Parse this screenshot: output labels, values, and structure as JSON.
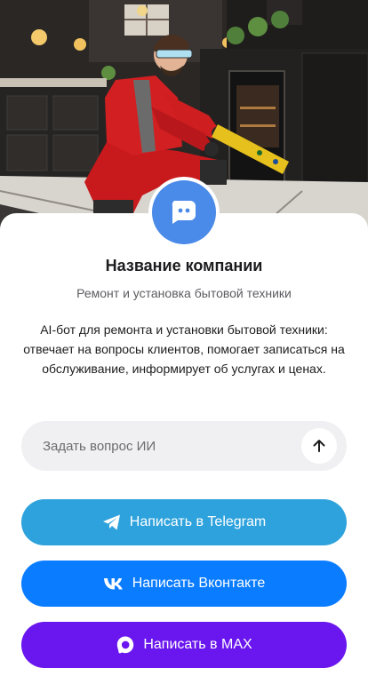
{
  "company": {
    "name": "Название компании",
    "subtitle": "Ремонт и установка бытовой техники",
    "description": "AI-бот для ремонта и установки бытовой техники: отвечает на вопросы клиентов, помогает записаться на обслуживание, информирует об услугах и ценах."
  },
  "avatar": {
    "icon": "chat-bot-icon",
    "color": "#4a8ae8"
  },
  "ask": {
    "placeholder": "Задать вопрос ИИ",
    "value": "",
    "send_icon": "arrow-up-icon"
  },
  "buttons": [
    {
      "label": "Написать в Telegram",
      "icon": "telegram-icon",
      "color": "#2ea2dc"
    },
    {
      "label": "Написать Вконтакте",
      "icon": "vk-icon",
      "color": "#0a7cff"
    },
    {
      "label": "Написать в MAX",
      "icon": "max-icon",
      "color": "#6a16ee"
    }
  ],
  "hero": {
    "image": "technician-repairing-oven-photo"
  }
}
